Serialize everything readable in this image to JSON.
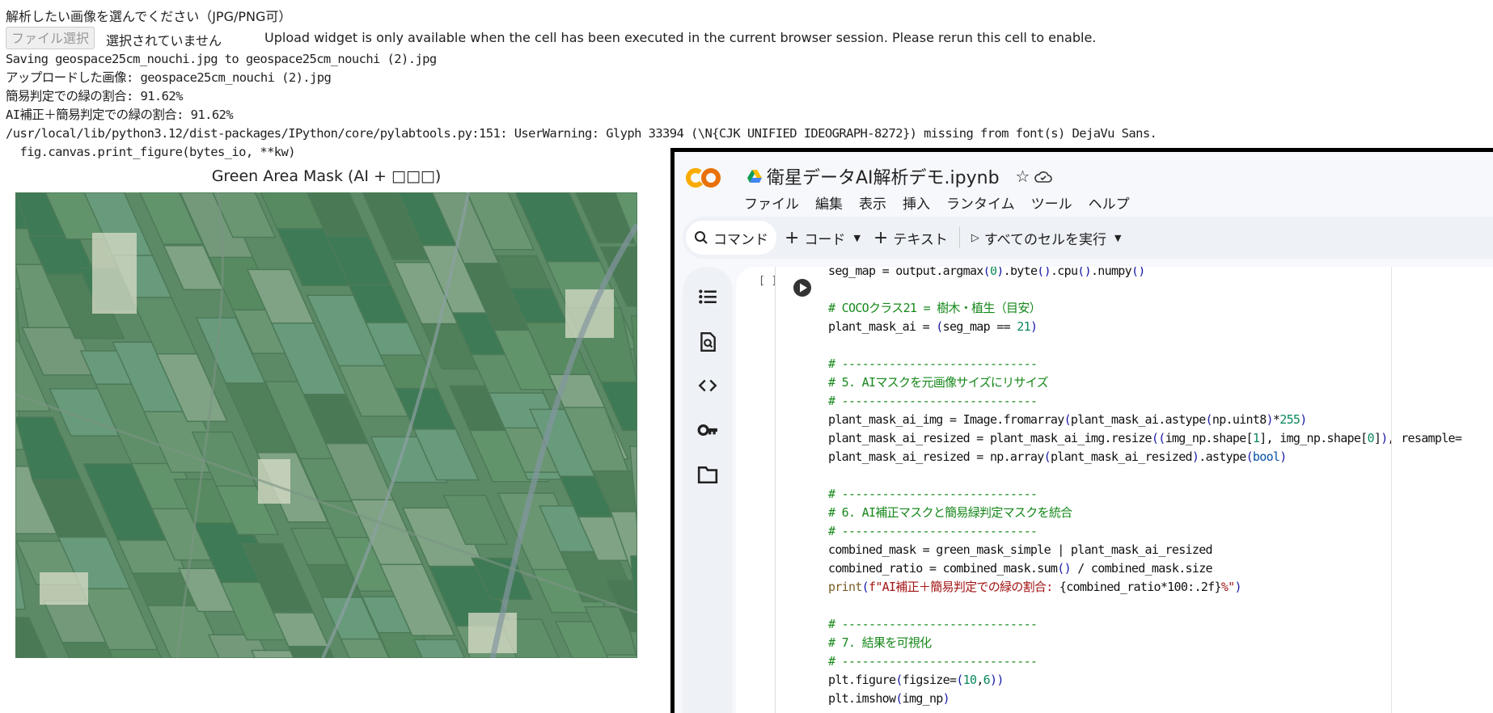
{
  "output": {
    "prompt": "解析したい画像を選んでください（JPG/PNG可）",
    "file_button": "ファイル選択",
    "no_file": "選択されていません",
    "upload_message": "Upload widget is only available when the cell has been executed in the current browser session. Please rerun this cell to enable.",
    "lines": [
      "Saving geospace25cm_nouchi.jpg to geospace25cm_nouchi (2).jpg",
      "アップロードした画像: geospace25cm_nouchi (2).jpg",
      "簡易判定での緑の割合: 91.62%",
      "AI補正＋簡易判定での緑の割合: 91.62%",
      "/usr/local/lib/python3.12/dist-packages/IPython/core/pylabtools.py:151: UserWarning: Glyph 33394 (\\N{CJK UNIFIED IDEOGRAPH-8272}) missing from font(s) DejaVu Sans.",
      "  fig.canvas.print_figure(bytes_io, **kw)"
    ],
    "figure_title": "Green Area Mask (AI + □□□)"
  },
  "colab": {
    "notebook_title": "衛星データAI解析デモ.ipynb",
    "menu": [
      "ファイル",
      "編集",
      "表示",
      "挿入",
      "ランタイム",
      "ツール",
      "ヘルプ"
    ],
    "toolbar": {
      "command": "コマンド",
      "code": "コード",
      "text": "テキスト",
      "run_all": "すべてのセルを実行"
    },
    "exec_count": "[ ]",
    "code_lines": [
      [
        [
          "seg_map = output.argmax",
          ""
        ],
        [
          "(",
          "p"
        ],
        [
          "0",
          "n"
        ],
        [
          ")",
          "p"
        ],
        [
          ".byte",
          ""
        ],
        [
          "()",
          "p"
        ],
        [
          ".cpu",
          ""
        ],
        [
          "()",
          "p"
        ],
        [
          ".numpy",
          ""
        ],
        [
          "()",
          "p"
        ]
      ],
      [],
      [
        [
          "# COCOクラス21 = 樹木・植生（目安）",
          "c"
        ]
      ],
      [
        [
          "plant_mask_ai = ",
          ""
        ],
        [
          "(",
          "p"
        ],
        [
          "seg_map == ",
          ""
        ],
        [
          "21",
          "n"
        ],
        [
          ")",
          "p"
        ]
      ],
      [],
      [
        [
          "# -----------------------------",
          "c"
        ]
      ],
      [
        [
          "# 5. AIマスクを元画像サイズにリサイズ",
          "c"
        ]
      ],
      [
        [
          "# -----------------------------",
          "c"
        ]
      ],
      [
        [
          "plant_mask_ai_img = Image.fromarray",
          ""
        ],
        [
          "(",
          "p"
        ],
        [
          "plant_mask_ai.astype",
          ""
        ],
        [
          "(",
          "p"
        ],
        [
          "np.uint8",
          ""
        ],
        [
          ")",
          "p"
        ],
        [
          "*",
          ""
        ],
        [
          "255",
          "n"
        ],
        [
          ")",
          "p"
        ]
      ],
      [
        [
          "plant_mask_ai_resized = plant_mask_ai_img.resize",
          ""
        ],
        [
          "((",
          "p"
        ],
        [
          "img_np.shape[",
          ""
        ],
        [
          "1",
          "n"
        ],
        [
          "], img_np.shape[",
          ""
        ],
        [
          "0",
          "n"
        ],
        [
          "]",
          ""
        ],
        [
          ")",
          "p"
        ],
        [
          ", resample=",
          ""
        ]
      ],
      [
        [
          "plant_mask_ai_resized = np.array",
          ""
        ],
        [
          "(",
          "p"
        ],
        [
          "plant_mask_ai_resized",
          ""
        ],
        [
          ")",
          "p"
        ],
        [
          ".astype",
          ""
        ],
        [
          "(",
          "p"
        ],
        [
          "bool",
          "k"
        ],
        [
          ")",
          "p"
        ]
      ],
      [],
      [
        [
          "# -----------------------------",
          "c"
        ]
      ],
      [
        [
          "# 6. AI補正マスクと簡易緑判定マスクを統合",
          "c"
        ]
      ],
      [
        [
          "# -----------------------------",
          "c"
        ]
      ],
      [
        [
          "combined_mask = green_mask_simple | plant_mask_ai_resized",
          ""
        ]
      ],
      [
        [
          "combined_ratio = combined_mask.sum",
          ""
        ],
        [
          "()",
          "p"
        ],
        [
          " / combined_mask.size",
          ""
        ]
      ],
      [
        [
          "print",
          "f"
        ],
        [
          "(",
          "p"
        ],
        [
          "f\"AI補正＋簡易判定での緑の割合: ",
          "s"
        ],
        [
          "{combined_ratio*100:.2f}",
          ""
        ],
        [
          "%\"",
          "s"
        ],
        [
          ")",
          "p"
        ]
      ],
      [],
      [
        [
          "# -----------------------------",
          "c"
        ]
      ],
      [
        [
          "# 7. 結果を可視化",
          "c"
        ]
      ],
      [
        [
          "# -----------------------------",
          "c"
        ]
      ],
      [
        [
          "plt.figure",
          ""
        ],
        [
          "(",
          "p"
        ],
        [
          "figsize=",
          ""
        ],
        [
          "(",
          "p"
        ],
        [
          "10",
          "n"
        ],
        [
          ",",
          ""
        ],
        [
          "6",
          "n"
        ],
        [
          "))",
          "p"
        ]
      ],
      [
        [
          "plt.imshow",
          ""
        ],
        [
          "(",
          "p"
        ],
        [
          "img_np",
          ""
        ],
        [
          ")",
          "p"
        ]
      ]
    ],
    "sidebar_icons": [
      "toc-icon",
      "find-icon",
      "code-snippets-icon",
      "secrets-key-icon",
      "folder-icon"
    ],
    "colors": {
      "accent_orange": "#f9ab00",
      "accent_dark_orange": "#e8710a"
    }
  }
}
